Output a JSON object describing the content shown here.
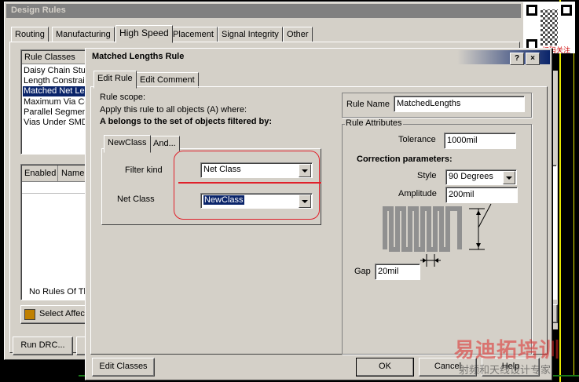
{
  "outer": {
    "title": "Design Rules",
    "tabs": [
      "Routing",
      "Manufacturing",
      "High Speed",
      "Placement",
      "Signal Integrity",
      "Other"
    ],
    "rule_classes_header": "Rule Classes",
    "rule_classes": [
      "Daisy Chain Stub",
      "Length Constrain",
      "Matched Net Le",
      "Maximum Via Co",
      "Parallel Segment",
      "Vias Under SMD"
    ],
    "enabled_header": "Enabled",
    "name_header": "Name",
    "no_rules": "No Rules Of Th",
    "select_affected": "Select Affec",
    "run_drc": "Run DRC..."
  },
  "dialog": {
    "title": "Matched Lengths Rule",
    "tabs": [
      "Edit Rule",
      "Edit Comment"
    ],
    "rule_scope": "Rule scope:",
    "apply_text": "Apply this rule to all objects (A) where:",
    "belongs_text": "A belongs to the set of objects filtered by:",
    "inner_tabs": [
      "NewClass",
      "And..."
    ],
    "filter_kind_label": "Filter kind",
    "filter_kind_value": "Net Class",
    "net_class_label": "Net Class",
    "net_class_value": "NewClass",
    "rule_name_label": "Rule Name",
    "rule_name_value": "MatchedLengths",
    "rule_attributes": "Rule Attributes",
    "tolerance_label": "Tolerance",
    "tolerance_value": "1000mil",
    "correction_label": "Correction parameters:",
    "style_label": "Style",
    "style_value": "90 Degrees",
    "amplitude_label": "Amplitude",
    "amplitude_value": "200mil",
    "gap_label": "Gap",
    "gap_value": "20mil",
    "edit_classes": "Edit Classes",
    "ok": "OK",
    "cancel": "Cancel",
    "help": "Help",
    "help_btn": "?",
    "close_btn": "×"
  },
  "watermark": {
    "line1": "易迪拓培训",
    "line2": "射频和天线设计专家",
    "side": "扫码关注"
  },
  "colors": {
    "window": "#d4d0c8",
    "title_active_start": "#0a246a",
    "title_active_end": "#a6caf0",
    "title_inactive": "#808080",
    "highlight": "#0a246a",
    "annotation_red": "#e0202a",
    "pcb_yellow": "#e8e800"
  }
}
